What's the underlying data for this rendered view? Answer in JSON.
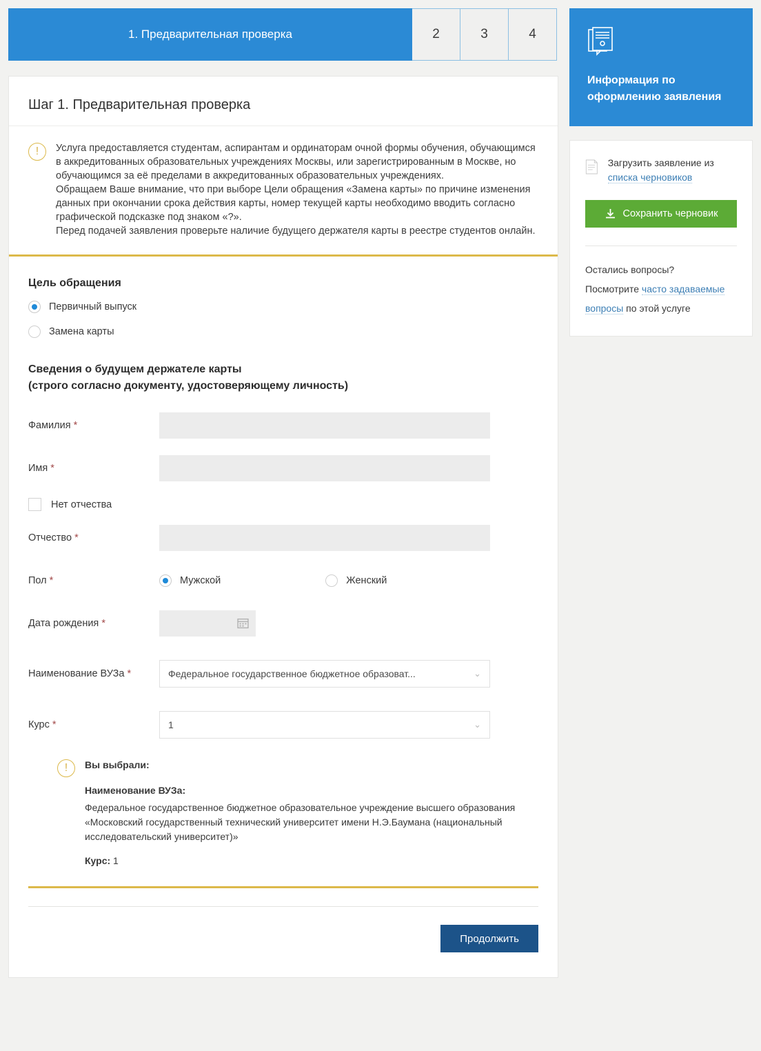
{
  "steps": [
    {
      "label": "1. Предварительная проверка",
      "active": true
    },
    {
      "label": "2",
      "active": false
    },
    {
      "label": "3",
      "active": false
    },
    {
      "label": "4",
      "active": false
    }
  ],
  "card": {
    "title": "Шаг 1. Предварительная проверка",
    "notice": {
      "icon": "exclamation-icon",
      "lines": [
        "Услуга предоставляется студентам, аспирантам и ординаторам очной формы обучения, обучающимся в аккредитованных образовательных учреждениях Москвы, или зарегистрированным в Москве, но обучающимся за её пределами в аккредитованных образовательных учреждениях.",
        "Обращаем Ваше внимание, что при выборе Цели обращения «Замена карты» по причине изменения данных при окончании срока действия карты, номер текущей карты необходимо вводить согласно графической подсказке под знаком «?».",
        "Перед подачей заявления проверьте наличие будущего держателя карты в реестре студентов онлайн."
      ]
    }
  },
  "form": {
    "purpose_heading": "Цель обращения",
    "purpose_options": [
      {
        "label": "Первичный выпуск",
        "checked": true
      },
      {
        "label": "Замена карты",
        "checked": false
      }
    ],
    "holder_heading_line1": "Сведения о будущем держателе карты",
    "holder_heading_line2": "(строго согласно документу, удостоверяющему личность)",
    "surname": {
      "label": "Фамилия",
      "required": "*",
      "value": "",
      "placeholder": ""
    },
    "firstname": {
      "label": "Имя",
      "required": "*",
      "value": "",
      "placeholder": ""
    },
    "no_patronymic": {
      "label": "Нет отчества",
      "checked": false
    },
    "patronymic": {
      "label": "Отчество",
      "required": "*",
      "value": "",
      "placeholder": ""
    },
    "gender": {
      "label": "Пол",
      "required": "*",
      "options": [
        {
          "label": "Мужской",
          "checked": true
        },
        {
          "label": "Женский",
          "checked": false
        }
      ]
    },
    "birthdate": {
      "label": "Дата рождения",
      "required": "*",
      "value": "",
      "icon": "calendar-icon"
    },
    "university": {
      "label": "Наименование ВУЗа",
      "required": "*",
      "value": "Федеральное государственное бюджетное образоват...",
      "chevron": "⌄"
    },
    "course": {
      "label": "Курс",
      "required": "*",
      "value": "1",
      "chevron": "⌄"
    }
  },
  "summary": {
    "icon": "exclamation-icon",
    "title": "Вы выбрали:",
    "university_label": "Наименование ВУЗа:",
    "university_value": "Федеральное государственное бюджетное образовательное учреждение высшего образования «Московский государственный технический университет имени Н.Э.Баумана (национальный исследовательский университет)»",
    "course_label": "Курс:",
    "course_value": "1"
  },
  "actions": {
    "continue_label": "Продолжить"
  },
  "sidebar": {
    "info_panel": {
      "icon": "documents-icon",
      "title": "Информация по оформлению заявления"
    },
    "draft": {
      "icon": "document-lines-icon",
      "text_before": "Загрузить заявление из ",
      "link_text": "списка черновиков",
      "save_button_label": "Сохранить черновик",
      "save_button_icon": "download-icon"
    },
    "faq": {
      "question": "Остались вопросы?",
      "prefix": "Посмотрите ",
      "link_text": "часто задаваемые вопросы",
      "suffix": " по этой услуге"
    }
  },
  "colors": {
    "brand_blue": "#2b8ad5",
    "button_blue": "#1c5389",
    "green": "#5cab36",
    "gold": "#dcb94a",
    "link": "#3d7fb5",
    "required_star": "#a34b4b",
    "page_bg": "#f2f2f0"
  }
}
